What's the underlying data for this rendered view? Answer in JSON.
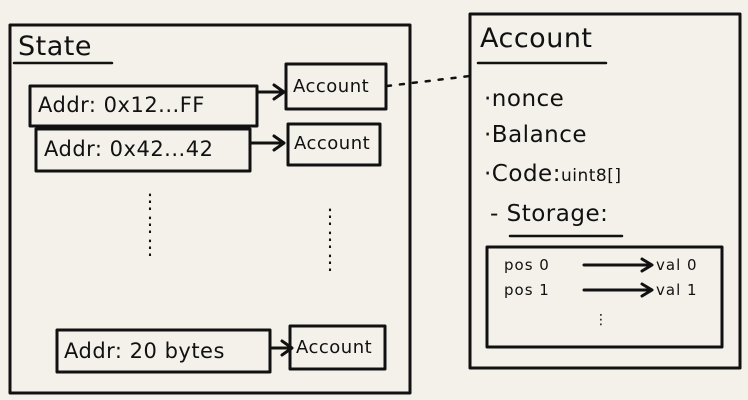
{
  "state": {
    "title": "State",
    "rows": [
      {
        "address": "Addr: 0x12...FF",
        "target": "Account"
      },
      {
        "address": "Addr: 0x42...42",
        "target": "Account"
      },
      {
        "address": "Addr: 20 bytes",
        "target": "Account"
      }
    ],
    "ellipsis": "⋮"
  },
  "account": {
    "title": "Account",
    "fields": {
      "nonce": "·nonce",
      "balance": "·Balance",
      "code_label": "·Code:",
      "code_type": "uint8[]",
      "storage": "- Storage:"
    },
    "storage_map": [
      {
        "key": "pos 0",
        "value": "val 0"
      },
      {
        "key": "pos 1",
        "value": "val 1"
      }
    ],
    "ellipsis": "⋮"
  }
}
